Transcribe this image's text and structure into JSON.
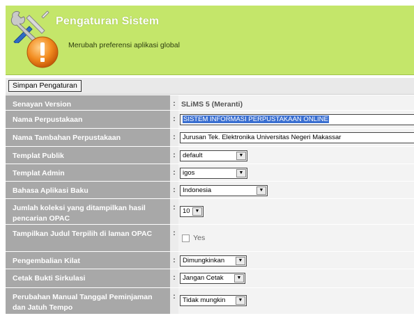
{
  "header": {
    "title": "Pengaturan Sistem",
    "subtitle": "Merubah preferensi aplikasi global",
    "tools_icon": "wrench-screwdriver-icon",
    "alert_icon": "exclamation-icon",
    "bg_color": "#c4e66a"
  },
  "toolbar": {
    "save_label": "Simpan Pengaturan"
  },
  "form": {
    "version": {
      "label": "Senayan Version",
      "value": "SLiMS 5 (Meranti)"
    },
    "library_name": {
      "label": "Nama Perpustakaan",
      "value": "SISTEM INFORMASI PERPUSTAKAAN ONLINE"
    },
    "library_subname": {
      "label": "Nama Tambahan Perpustakaan",
      "value": "Jurusan Tek. Elektronika Universitas Negeri Makassar"
    },
    "public_template": {
      "label": "Templat Publik",
      "value": "default"
    },
    "admin_template": {
      "label": "Templat Admin",
      "value": "igos"
    },
    "default_language": {
      "label": "Bahasa Aplikasi Baku",
      "value": "Indonesia"
    },
    "opac_results": {
      "label": "Jumlah koleksi yang ditampilkan hasil pencarian OPAC",
      "value": "10"
    },
    "promoted_titles": {
      "label": "Tampilkan Judul Terpilih di laman OPAC",
      "checkbox_label": "Yes"
    },
    "quick_return": {
      "label": "Pengembalian Kilat",
      "value": "Dimungkinkan"
    },
    "print_receipt": {
      "label": "Cetak Bukti Sirkulasi",
      "value": "Jangan Cetak"
    },
    "manual_dates": {
      "label": "Perubahan Manual Tanggal Peminjaman dan Jatuh Tempo",
      "value": "Tidak mungkin"
    },
    "colon": ":"
  }
}
